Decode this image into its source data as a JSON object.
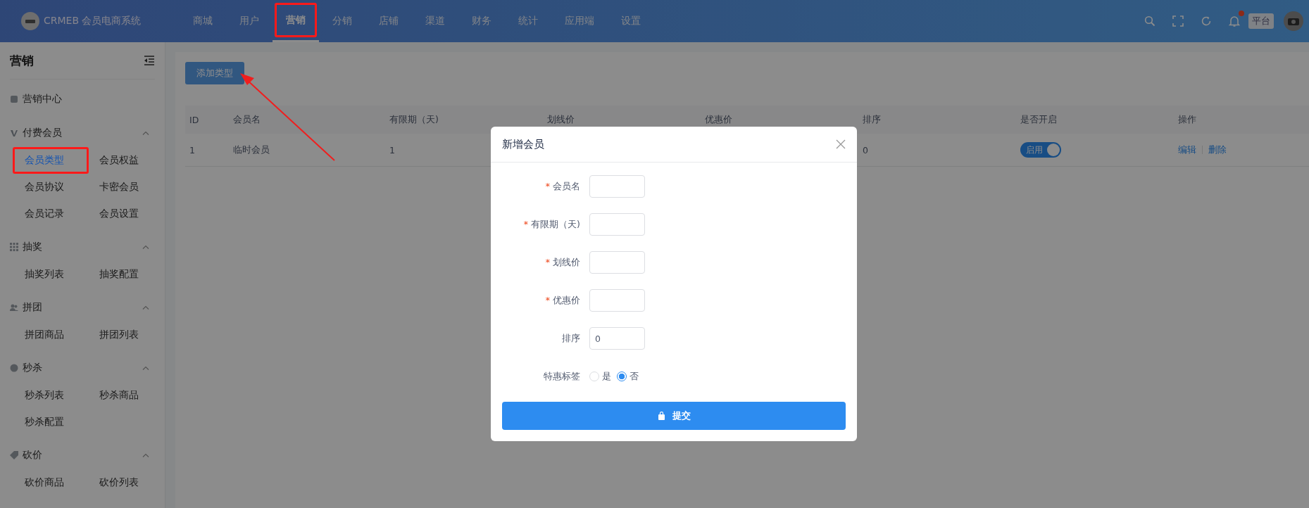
{
  "topbar": {
    "logo_text": "CRMEB 会员电商系统",
    "nav": [
      {
        "label": "商城",
        "selected": false,
        "annotated": false
      },
      {
        "label": "用户",
        "selected": false,
        "annotated": false
      },
      {
        "label": "营销",
        "selected": true,
        "annotated": true
      },
      {
        "label": "分销",
        "selected": false,
        "annotated": false
      },
      {
        "label": "店铺",
        "selected": false,
        "annotated": false
      },
      {
        "label": "渠道",
        "selected": false,
        "annotated": false
      },
      {
        "label": "财务",
        "selected": false,
        "annotated": false
      },
      {
        "label": "统计",
        "selected": false,
        "annotated": false
      },
      {
        "label": "应用端",
        "selected": false,
        "annotated": false
      },
      {
        "label": "设置",
        "selected": false,
        "annotated": false
      }
    ],
    "notification": true,
    "role_badge": "平台"
  },
  "sidebar": {
    "title": "营销",
    "groups": [
      {
        "label": "营销中心"
      },
      {
        "label": "付费会员",
        "expanded": true,
        "items": [
          {
            "label": "会员类型",
            "selected": true,
            "annotated": true
          },
          {
            "label": "会员权益",
            "selected": false,
            "annotated": false
          },
          {
            "label": "会员协议",
            "selected": false,
            "annotated": false
          },
          {
            "label": "卡密会员",
            "selected": false,
            "annotated": false
          },
          {
            "label": "会员记录",
            "selected": false,
            "annotated": false
          },
          {
            "label": "会员设置",
            "selected": false,
            "annotated": false
          }
        ]
      },
      {
        "label": "抽奖",
        "expanded": true,
        "items": [
          {
            "label": "抽奖列表",
            "selected": false,
            "annotated": false
          },
          {
            "label": "抽奖配置",
            "selected": false,
            "annotated": false
          }
        ]
      },
      {
        "label": "拼团",
        "expanded": true,
        "items": [
          {
            "label": "拼团商品",
            "selected": false,
            "annotated": false
          },
          {
            "label": "拼团列表",
            "selected": false,
            "annotated": false
          }
        ]
      },
      {
        "label": "秒杀",
        "expanded": true,
        "items": [
          {
            "label": "秒杀列表",
            "selected": false,
            "annotated": false
          },
          {
            "label": "秒杀商品",
            "selected": false,
            "annotated": false
          },
          {
            "label": "秒杀配置",
            "selected": false,
            "annotated": false
          }
        ]
      },
      {
        "label": "砍价",
        "expanded": true,
        "items": [
          {
            "label": "砍价商品",
            "selected": false,
            "annotated": false
          },
          {
            "label": "砍价列表",
            "selected": false,
            "annotated": false
          }
        ]
      }
    ]
  },
  "content": {
    "add_button": {
      "label": "添加类型",
      "annotated": true
    },
    "table": {
      "columns": [
        "ID",
        "会员名",
        "有限期（天)",
        "划线价",
        "优惠价",
        "排序",
        "是否开启",
        "操作"
      ],
      "rows": [
        {
          "id": "1",
          "name": "临时会员",
          "validity": "1",
          "sort": "0",
          "enabled": true,
          "toggle_label": "启用",
          "actions": [
            "编辑",
            "删除"
          ]
        }
      ]
    }
  },
  "modal": {
    "title": "新增会员",
    "required_mark": "*",
    "fields": [
      {
        "label": "会员名",
        "required": true
      },
      {
        "label": "有限期（天)",
        "required": true
      },
      {
        "label": "划线价",
        "required": true
      },
      {
        "label": "优惠价",
        "required": true
      },
      {
        "label": "排序",
        "required": false,
        "value": "0"
      }
    ],
    "radio": {
      "label": "特惠标签",
      "options": [
        {
          "label": "是",
          "selected": false
        },
        {
          "label": "否",
          "selected": true
        }
      ]
    },
    "submit": "提交"
  }
}
